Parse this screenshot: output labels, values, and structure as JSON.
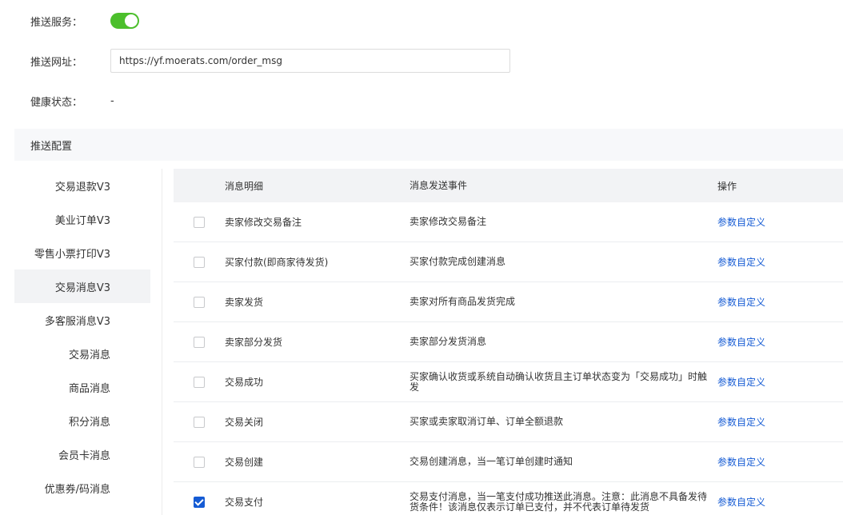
{
  "colors": {
    "toggle_on": "#4cbf2c",
    "link": "#155bd4",
    "checkbox_checked": "#155bd4"
  },
  "form": {
    "service_label": "推送服务：",
    "service_enabled": true,
    "url_label": "推送网址：",
    "url_value": "https://yf.moerats.com/order_msg",
    "health_label": "健康状态：",
    "health_value": "-"
  },
  "section": {
    "title": "推送配置"
  },
  "sidebar": {
    "items": [
      {
        "label": "交易退款V3"
      },
      {
        "label": "美业订单V3"
      },
      {
        "label": "零售小票打印V3"
      },
      {
        "label": "交易消息V3",
        "active": true
      },
      {
        "label": "多客服消息V3"
      },
      {
        "label": "交易消息"
      },
      {
        "label": "商品消息"
      },
      {
        "label": "积分消息"
      },
      {
        "label": "会员卡消息"
      },
      {
        "label": "优惠券/码消息"
      }
    ]
  },
  "table": {
    "headers": {
      "detail": "消息明细",
      "event": "消息发送事件",
      "op": "操作"
    },
    "rows": [
      {
        "checked": false,
        "detail": "卖家修改交易备注",
        "event": "卖家修改交易备注",
        "op": "参数自定义"
      },
      {
        "checked": false,
        "detail": "买家付款(即商家待发货)",
        "event": "买家付款完成创建消息",
        "op": "参数自定义"
      },
      {
        "checked": false,
        "detail": "卖家发货",
        "event": "卖家对所有商品发货完成",
        "op": "参数自定义"
      },
      {
        "checked": false,
        "detail": "卖家部分发货",
        "event": "卖家部分发货消息",
        "op": "参数自定义"
      },
      {
        "checked": false,
        "detail": "交易成功",
        "event": "买家确认收货或系统自动确认收货且主订单状态变为「交易成功」时触发",
        "op": "参数自定义"
      },
      {
        "checked": false,
        "detail": "交易关闭",
        "event": "买家或卖家取消订单、订单全额退款",
        "op": "参数自定义"
      },
      {
        "checked": false,
        "detail": "交易创建",
        "event": "交易创建消息，当一笔订单创建时通知",
        "op": "参数自定义"
      },
      {
        "checked": true,
        "detail": "交易支付",
        "event": "交易支付消息，当一笔支付成功推送此消息。注意：此消息不具备发待货条件！该消息仅表示订单已支付，并不代表订单待发货",
        "op": "参数自定义"
      }
    ]
  }
}
